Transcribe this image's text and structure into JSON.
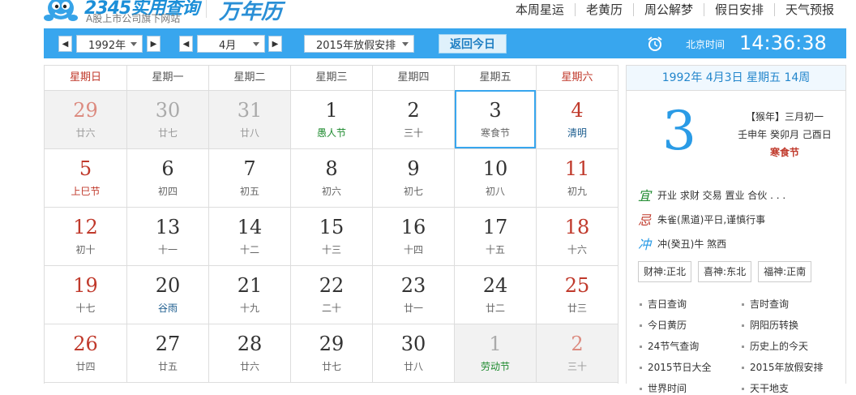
{
  "header": {
    "logo_brand": "2345实用查询",
    "logo_sub": "A股上市公司旗下网站",
    "site_title": "万年历",
    "nav": [
      "本周星运",
      "老黄历",
      "周公解梦",
      "假日安排",
      "天气预报"
    ]
  },
  "toolbar": {
    "year_value": "1992年",
    "month_value": "4月",
    "holiday_value": "2015年放假安排",
    "today_label": "返回今日",
    "beijing_label": "北京时间",
    "time": "14:36:38"
  },
  "weekdays": [
    "星期日",
    "星期一",
    "星期二",
    "星期三",
    "星期四",
    "星期五",
    "星期六"
  ],
  "weeks": [
    [
      {
        "num": "29",
        "sub": "廿六",
        "other": true
      },
      {
        "num": "30",
        "sub": "廿七",
        "other": true
      },
      {
        "num": "31",
        "sub": "廿八",
        "other": true
      },
      {
        "num": "1",
        "sub": "愚人节",
        "color": "green"
      },
      {
        "num": "2",
        "sub": "三十"
      },
      {
        "num": "3",
        "sub": "寒食节",
        "selected": true
      },
      {
        "num": "4",
        "sub": "清明",
        "color": "blue"
      }
    ],
    [
      {
        "num": "5",
        "sub": "上巳节",
        "color": "red"
      },
      {
        "num": "6",
        "sub": "初四"
      },
      {
        "num": "7",
        "sub": "初五"
      },
      {
        "num": "8",
        "sub": "初六"
      },
      {
        "num": "9",
        "sub": "初七"
      },
      {
        "num": "10",
        "sub": "初八"
      },
      {
        "num": "11",
        "sub": "初九"
      }
    ],
    [
      {
        "num": "12",
        "sub": "初十"
      },
      {
        "num": "13",
        "sub": "十一"
      },
      {
        "num": "14",
        "sub": "十二"
      },
      {
        "num": "15",
        "sub": "十三"
      },
      {
        "num": "16",
        "sub": "十四"
      },
      {
        "num": "17",
        "sub": "十五"
      },
      {
        "num": "18",
        "sub": "十六"
      }
    ],
    [
      {
        "num": "19",
        "sub": "十七"
      },
      {
        "num": "20",
        "sub": "谷雨",
        "color": "blue"
      },
      {
        "num": "21",
        "sub": "十九"
      },
      {
        "num": "22",
        "sub": "二十"
      },
      {
        "num": "23",
        "sub": "廿一"
      },
      {
        "num": "24",
        "sub": "廿二"
      },
      {
        "num": "25",
        "sub": "廿三"
      }
    ],
    [
      {
        "num": "26",
        "sub": "廿四"
      },
      {
        "num": "27",
        "sub": "廿五"
      },
      {
        "num": "28",
        "sub": "廿六"
      },
      {
        "num": "29",
        "sub": "廿七"
      },
      {
        "num": "30",
        "sub": "廿八"
      },
      {
        "num": "1",
        "sub": "劳动节",
        "other": true,
        "color": "green"
      },
      {
        "num": "2",
        "sub": "三十",
        "other": true
      }
    ]
  ],
  "side": {
    "header": "1992年 4月3日 星期五 14周",
    "big_day": "3",
    "lunar_line1": "【猴年】三月初一",
    "lunar_line2": "壬申年  癸卯月  己酉日",
    "festival": "寒食节",
    "yi_char": "宜",
    "yi_text": "开业  求财  交易  置业  合伙  . . .",
    "ji_char": "忌",
    "ji_text": "朱雀(黑道)平日,谨慎行事",
    "chong_char": "冲",
    "chong_text": "冲(癸丑)牛    煞西",
    "shen": [
      "财神:正北",
      "喜神:东北",
      "福神:正南"
    ],
    "links": [
      "吉日查询",
      "吉时查询",
      "今日黄历",
      "阴阳历转换",
      "24节气查询",
      "历史上的今天",
      "2015节日大全",
      "2015年放假安排",
      "世界时间",
      "天干地支"
    ]
  },
  "colors": {
    "accent": "#38a6ee",
    "holiday_red": "#c0392b",
    "festival_green": "#1d8a2e",
    "solar_term_blue": "#1b5c8e"
  }
}
